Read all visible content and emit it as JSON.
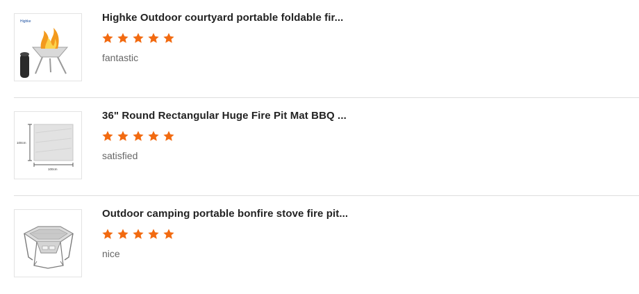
{
  "reviews": [
    {
      "product_title": "Highke Outdoor courtyard portable foldable fir...",
      "rating": 5,
      "comment": "fantastic",
      "image_icon": "fire-pit-with-flames-and-carry-bag",
      "image_logo_text": "Highke"
    },
    {
      "product_title": "36\" Round Rectangular Huge Fire Pit Mat BBQ ...",
      "rating": 5,
      "comment": "satisfied",
      "image_icon": "fire-pit-mat-with-dimensions",
      "image_dim_labels": [
        "100cm",
        "100cm"
      ]
    },
    {
      "product_title": "Outdoor camping portable bonfire stove fire pit...",
      "rating": 5,
      "comment": "nice",
      "image_icon": "folding-bonfire-stove"
    }
  ],
  "colors": {
    "star": "#f26a10",
    "title": "#222222",
    "comment": "#666666",
    "divider": "#dddddd"
  }
}
